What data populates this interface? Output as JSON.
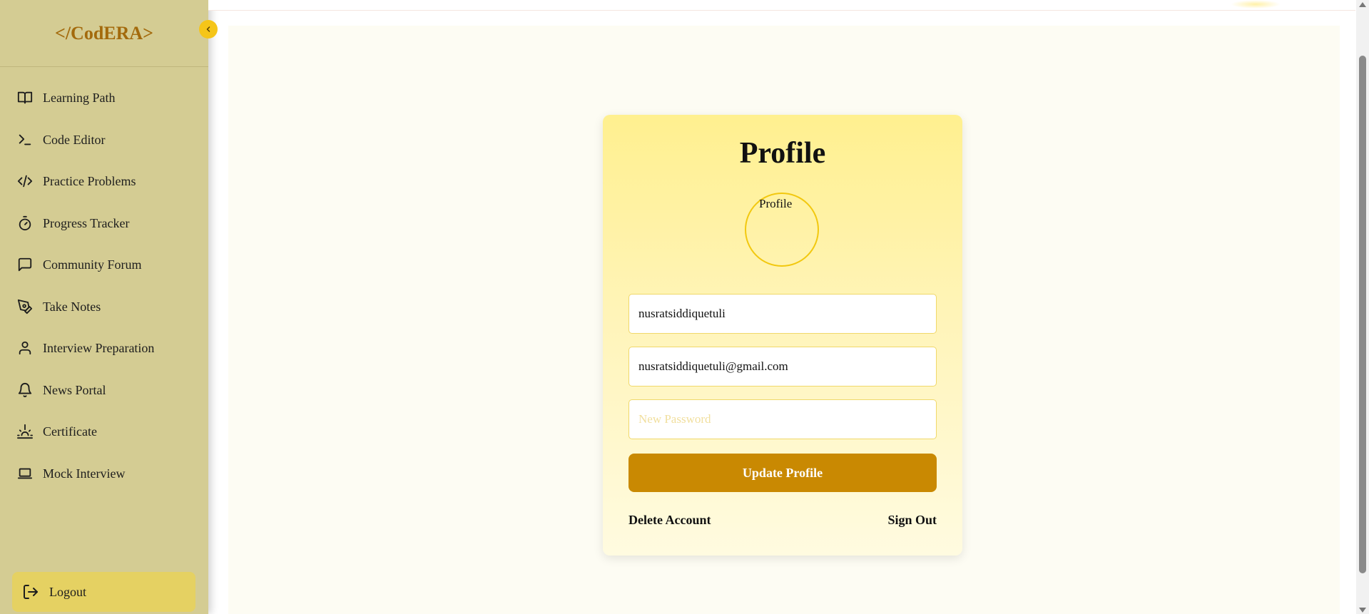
{
  "brand": {
    "name": "</CodERA>"
  },
  "sidebar": {
    "items": [
      {
        "label": "Learning Path",
        "icon": "book-icon"
      },
      {
        "label": "Code Editor",
        "icon": "terminal-icon"
      },
      {
        "label": "Practice Problems",
        "icon": "code-icon"
      },
      {
        "label": "Progress Tracker",
        "icon": "timer-icon"
      },
      {
        "label": "Community Forum",
        "icon": "chat-icon"
      },
      {
        "label": "Take Notes",
        "icon": "pen-icon"
      },
      {
        "label": "Interview Preparation",
        "icon": "user-icon"
      },
      {
        "label": "News Portal",
        "icon": "bell-icon"
      },
      {
        "label": "Certificate",
        "icon": "sunrise-icon"
      },
      {
        "label": "Mock Interview",
        "icon": "laptop-icon"
      }
    ],
    "logout_label": "Logout"
  },
  "profile": {
    "title": "Profile",
    "avatar_alt": "Profile",
    "username": "nusratsiddiquetuli",
    "email": "nusratsiddiquetuli@gmail.com",
    "password_placeholder": "New Password",
    "update_label": "Update Profile",
    "delete_label": "Delete Account",
    "signout_label": "Sign Out"
  },
  "colors": {
    "sidebar_bg": "#d4cc93",
    "brand": "#a36a0c",
    "accent": "#c98902",
    "toggle": "#f5c518",
    "logout_bg": "#e5d162"
  }
}
